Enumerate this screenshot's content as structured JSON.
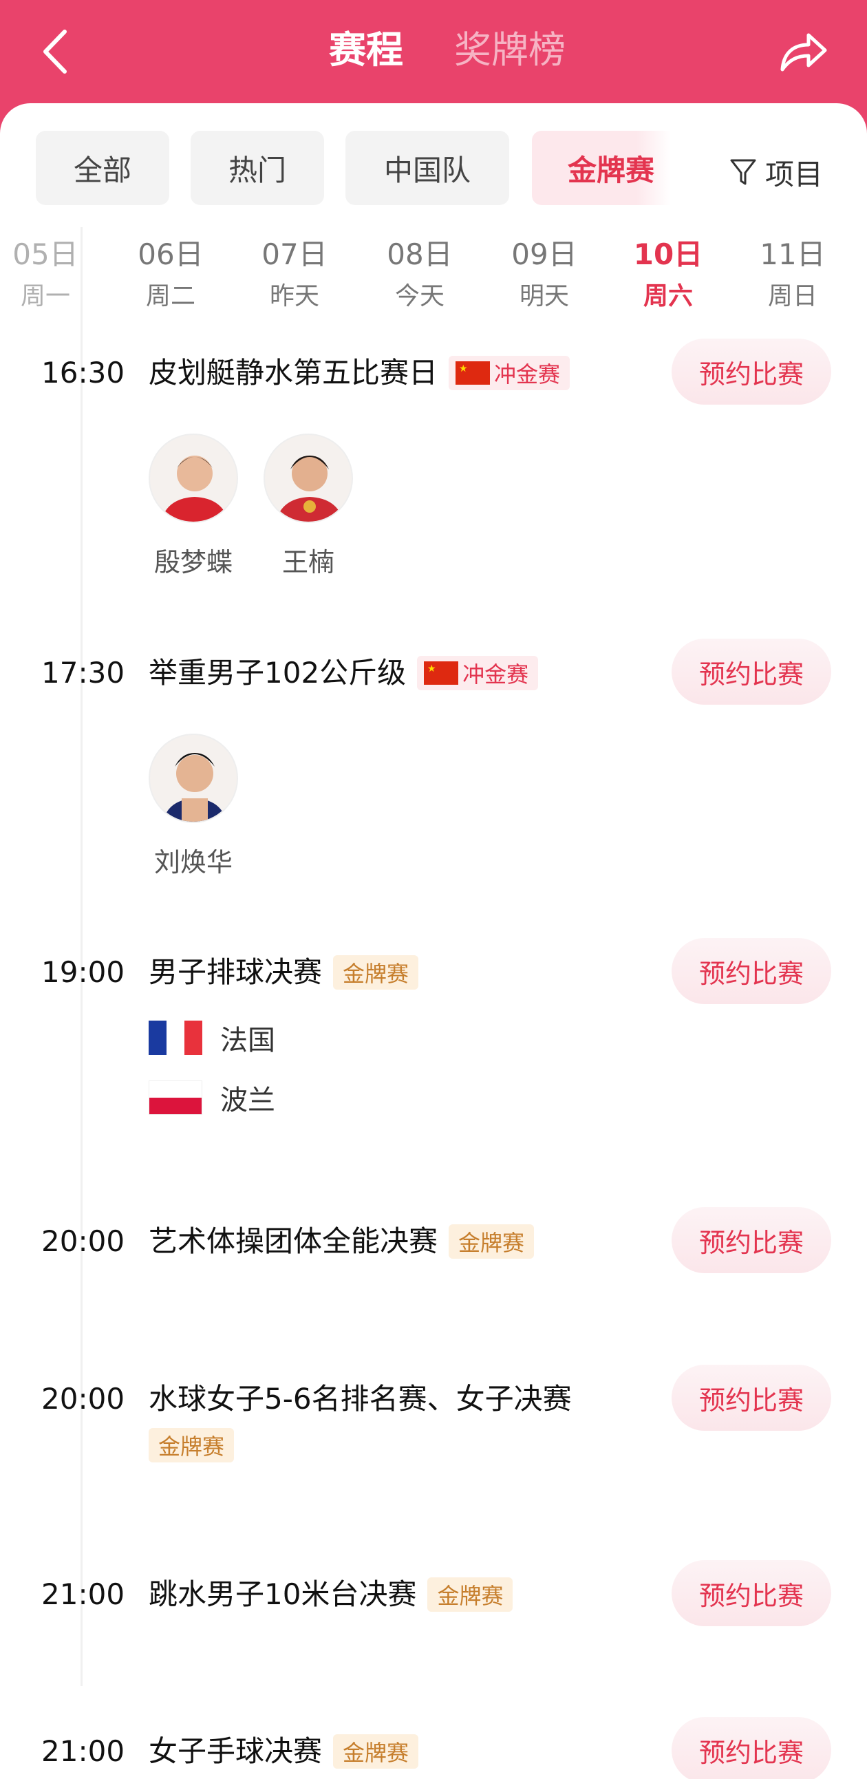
{
  "header": {
    "active_tab": "赛程",
    "inactive_tab": "奖牌榜",
    "back_icon": "chevron-left-icon",
    "share_icon": "share-arrow-icon",
    "bg_color": "#e9436b"
  },
  "filters": {
    "chips": [
      "全部",
      "热门",
      "中国队",
      "金牌赛"
    ],
    "active": "金牌赛",
    "filter_label": "项目",
    "filter_icon": "funnel-icon"
  },
  "dates": [
    {
      "day": "05日",
      "weekday": "周一"
    },
    {
      "day": "06日",
      "weekday": "周二"
    },
    {
      "day": "07日",
      "weekday": "昨天"
    },
    {
      "day": "08日",
      "weekday": "今天"
    },
    {
      "day": "09日",
      "weekday": "明天"
    },
    {
      "day": "10日",
      "weekday": "周六"
    },
    {
      "day": "11日",
      "weekday": "周日"
    }
  ],
  "active_date": "10日",
  "reserve_label": "预约比赛",
  "tags": {
    "gold": "金牌赛",
    "china_gold": "冲金赛"
  },
  "events": [
    {
      "time": "16:30",
      "title": "皮划艇静水第五比赛日",
      "tag": "冲金赛",
      "athletes": [
        "殷梦蝶",
        "王楠"
      ]
    },
    {
      "time": "17:30",
      "title": "举重男子102公斤级",
      "tag": "冲金赛",
      "athletes": [
        "刘焕华"
      ]
    },
    {
      "time": "19:00",
      "title": "男子排球决赛",
      "tag": "金牌赛",
      "teams": [
        "法国",
        "波兰"
      ]
    },
    {
      "time": "20:00",
      "title": "艺术体操团体全能决赛",
      "tag": "金牌赛"
    },
    {
      "time": "20:00",
      "title": "水球女子5-6名排名赛、女子决赛",
      "tag": "金牌赛"
    },
    {
      "time": "21:00",
      "title": "跳水男子10米台决赛",
      "tag": "金牌赛"
    },
    {
      "time": "21:00",
      "title": "女子手球决赛",
      "tag": "金牌赛"
    }
  ]
}
